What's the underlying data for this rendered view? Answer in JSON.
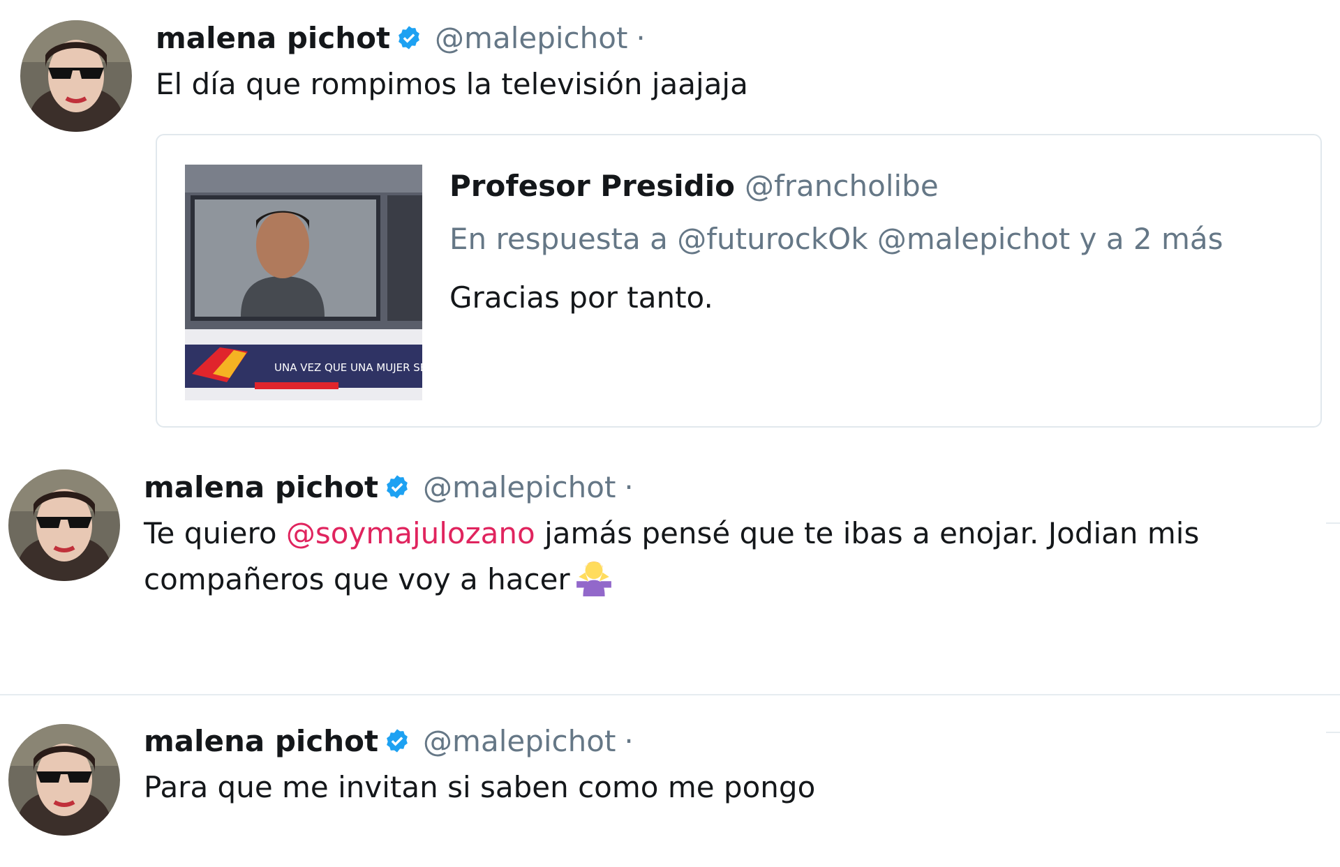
{
  "tweets": [
    {
      "name": "malena pichot",
      "handle": "@malepichot",
      "separator": "·",
      "text": "El día que rompimos la televisión jaajaja",
      "quoted": {
        "name": "Profesor Presidio",
        "handle": "@francholibe",
        "reply_context": "En respuesta a @futurockOk @malepichot y a 2 más",
        "text": "Gracias por tanto.",
        "thumbnail_caption": "UNA VEZ QUE UNA MUJER SE METE"
      }
    },
    {
      "name": "malena pichot",
      "handle": "@malepichot",
      "separator": "·",
      "text_before": "Te quiero ",
      "mention": "@soymajulozano",
      "text_after_line1": " jamás pensé que te ibas a enojar. Jodian mis",
      "text_line2": "compañeros que voy a hacer",
      "emoji": "person-shrugging-emoji"
    },
    {
      "name": "malena pichot",
      "handle": "@malepichot",
      "separator": "·",
      "text": "Para que me invitan si saben como me pongo"
    }
  ],
  "colors": {
    "verified_badge": "#1da1f2",
    "mention": "#e0245e",
    "secondary_text": "#657786",
    "border": "#e1e8ed"
  }
}
